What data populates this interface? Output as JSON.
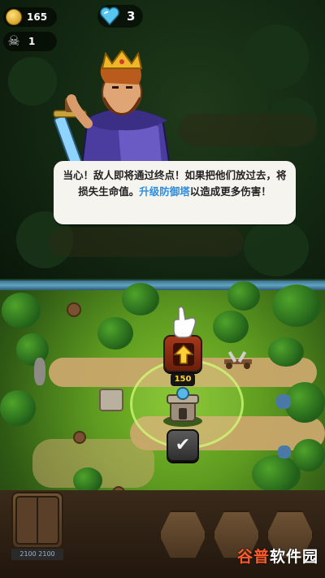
{
  "hud": {
    "gold": "165",
    "kills": "1",
    "lives": "3"
  },
  "dialog": {
    "text_before": "当心！敌人即将通过终点！如果把他们放过去，将损失生命值。",
    "highlight": "升级防御塔",
    "text_after": "以造成更多伤害！"
  },
  "tower": {
    "upgrade_cost": "150"
  },
  "card": {
    "value": "2100 2100"
  },
  "watermark": {
    "part1": "谷普",
    "part2": "软件园"
  },
  "colors": {
    "highlight": "#2b8de0",
    "cost": "#ffd42a",
    "upgrade_button": "#a5381a"
  },
  "icons": {
    "gold": "coin-icon",
    "kills": "skull-icon",
    "lives": "heart-icon",
    "upgrade": "up-arrow-icon",
    "confirm": "checkmark-icon"
  }
}
